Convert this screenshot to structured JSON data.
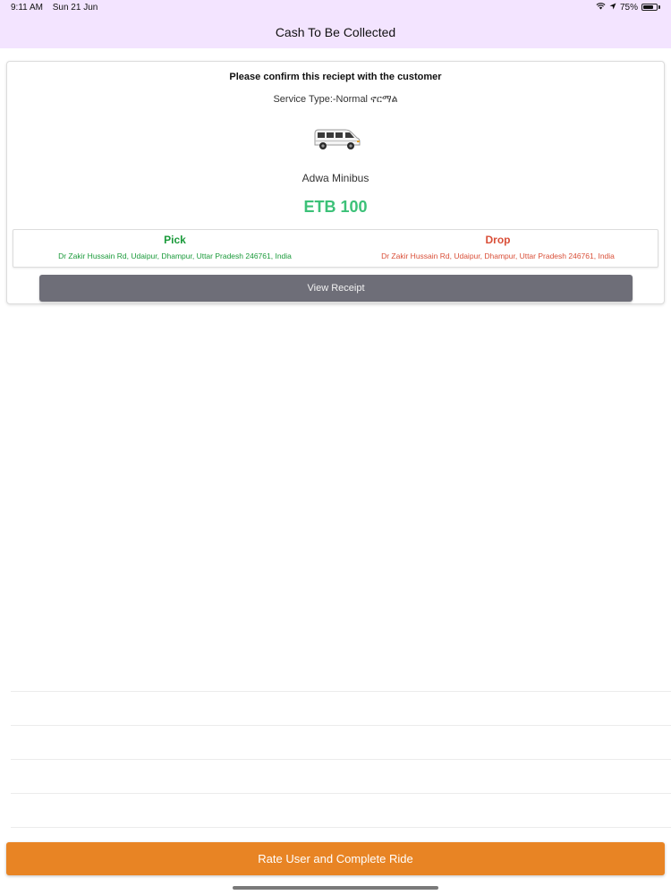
{
  "status_bar": {
    "time": "9:11 AM",
    "date": "Sun 21 Jun",
    "battery": "75%",
    "battery_level": 0.75,
    "icons": [
      "wifi-icon",
      "location-arrow-icon",
      "battery-icon"
    ]
  },
  "navbar": {
    "title": "Cash To Be Collected"
  },
  "receipt": {
    "confirm_text": "Please confirm this reciept with the customer",
    "service_type": "Service Type:-Normal  ኖርማል",
    "vehicle_icon": "minibus-icon",
    "vehicle_name": "Adwa Minibus",
    "fare": "ETB 100",
    "pick": {
      "label": "Pick",
      "address": "Dr Zakir Hussain Rd, Udaipur, Dhampur, Uttar Pradesh 246761, India"
    },
    "drop": {
      "label": "Drop",
      "address": "Dr Zakir Hussain Rd, Udaipur, Dhampur, Uttar Pradesh 246761, India"
    },
    "view_receipt_label": "View Receipt"
  },
  "colors": {
    "accent_purple": "#f3e4ff",
    "fare_green": "#3cc178",
    "pick_green": "#1a9a3a",
    "drop_red": "#d94f38",
    "button_gray": "#6e6e78",
    "button_orange": "#e88424"
  },
  "footer": {
    "complete_label": "Rate User and Complete Ride"
  }
}
